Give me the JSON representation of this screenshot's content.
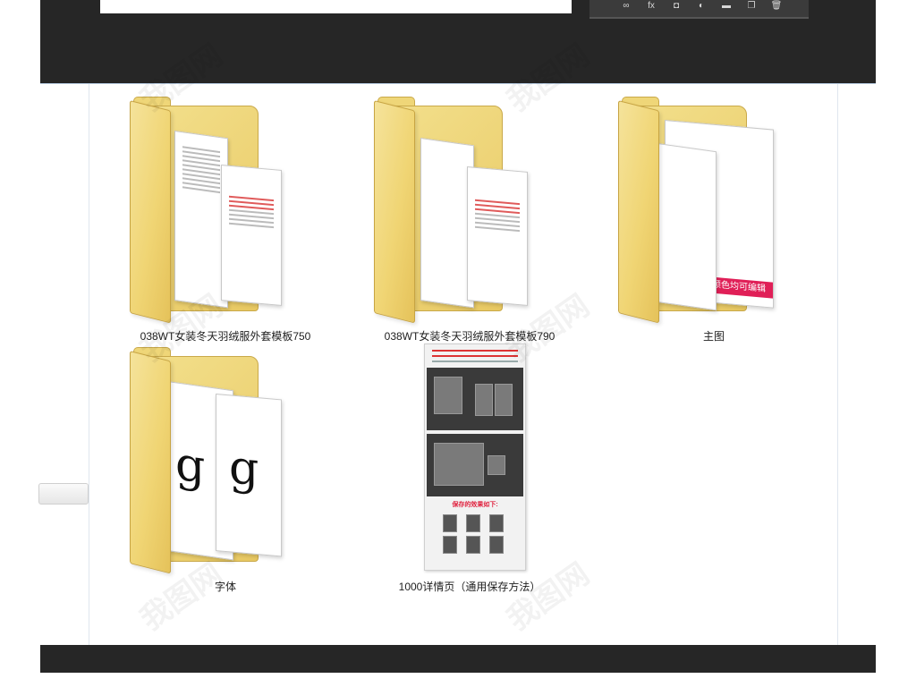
{
  "items": [
    {
      "name": "038WT女装冬天羽绒服外套模板750",
      "type": "folder"
    },
    {
      "name": "038WT女装冬天羽绒服外套模板790",
      "type": "folder"
    },
    {
      "name": "主图",
      "type": "folder"
    },
    {
      "name": "字体",
      "type": "folder"
    },
    {
      "name": "1000详情页（通用保存方法）",
      "type": "image"
    }
  ],
  "main_folder": {
    "band_text": "颜色均可编辑"
  },
  "font_folder": {
    "glyph": "g"
  },
  "detail_thumb": {
    "caption": "保存的效果如下:"
  },
  "toolbar": {
    "fx_label": "fx"
  },
  "colors": {
    "folder": "#f0d574",
    "accent": "#e01f57",
    "dark_bar": "#262626"
  }
}
